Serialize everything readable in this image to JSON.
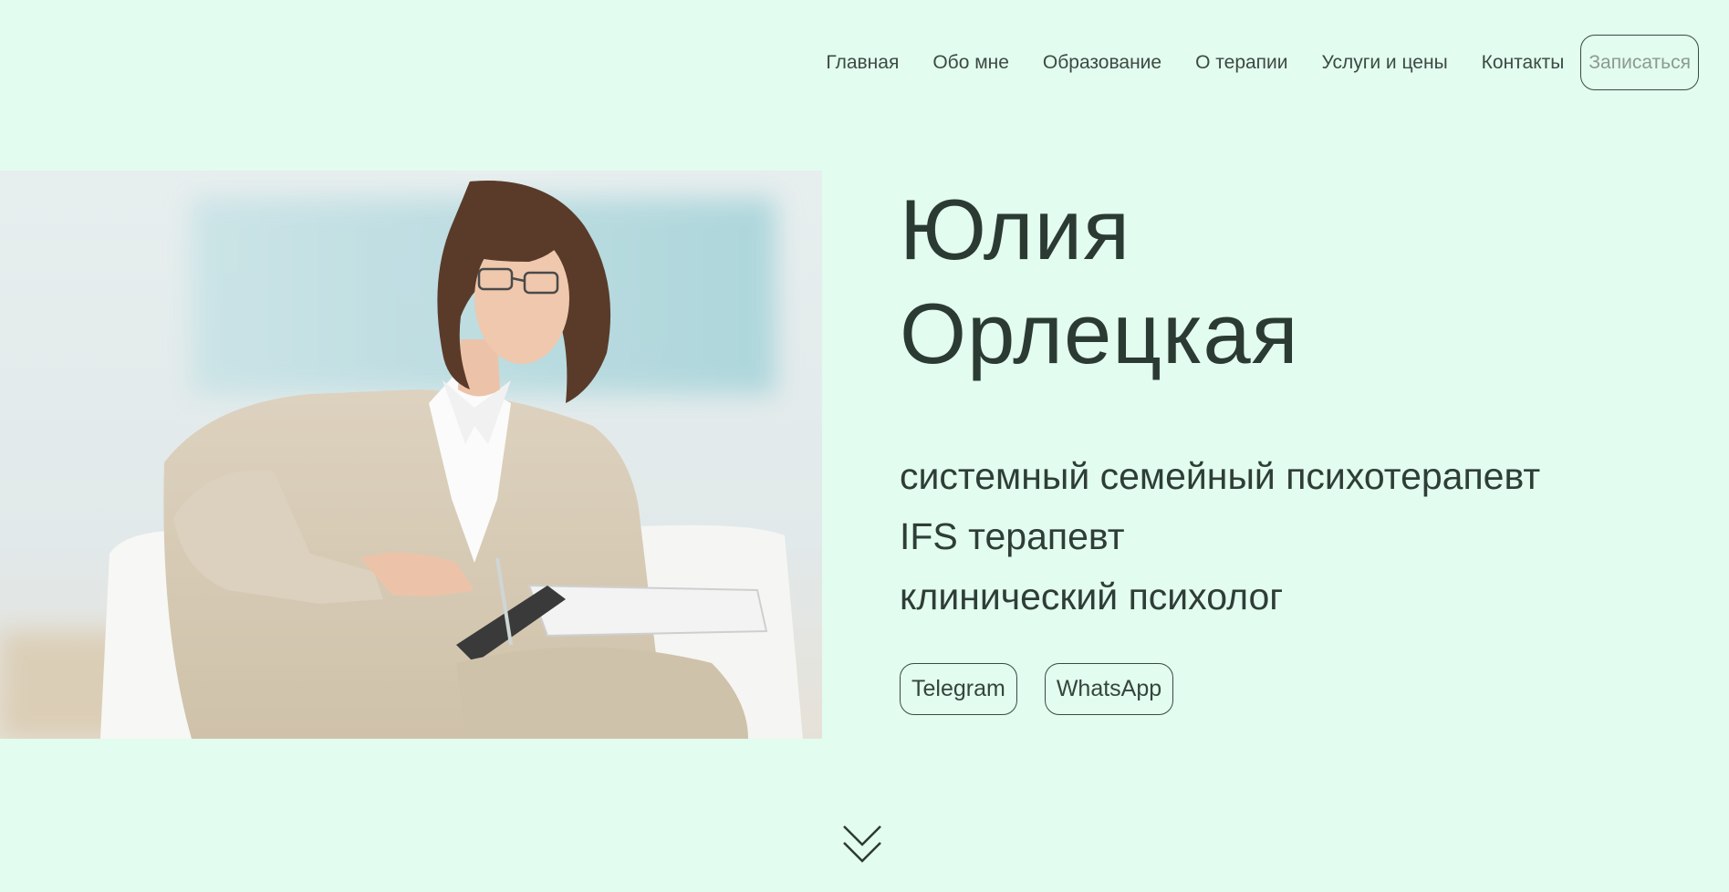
{
  "nav": {
    "items": [
      {
        "label": "Главная"
      },
      {
        "label": "Обо мне"
      },
      {
        "label": "Образование"
      },
      {
        "label": "О терапии"
      },
      {
        "label": "Услуги и цены"
      },
      {
        "label": "Контакты"
      }
    ],
    "cta_label": "Записаться"
  },
  "hero": {
    "first_name": "Юлия",
    "last_name": "Орлецкая",
    "roles": [
      "системный семейный психотерапевт",
      "IFS терапевт",
      "клинический психолог"
    ],
    "contacts": [
      {
        "label": "Telegram"
      },
      {
        "label": "WhatsApp"
      }
    ]
  },
  "icons": {
    "scroll": "chevron-double-down-icon"
  },
  "colors": {
    "background": "#e2fcef",
    "text": "#2b3b33",
    "border": "#3a4a43"
  }
}
